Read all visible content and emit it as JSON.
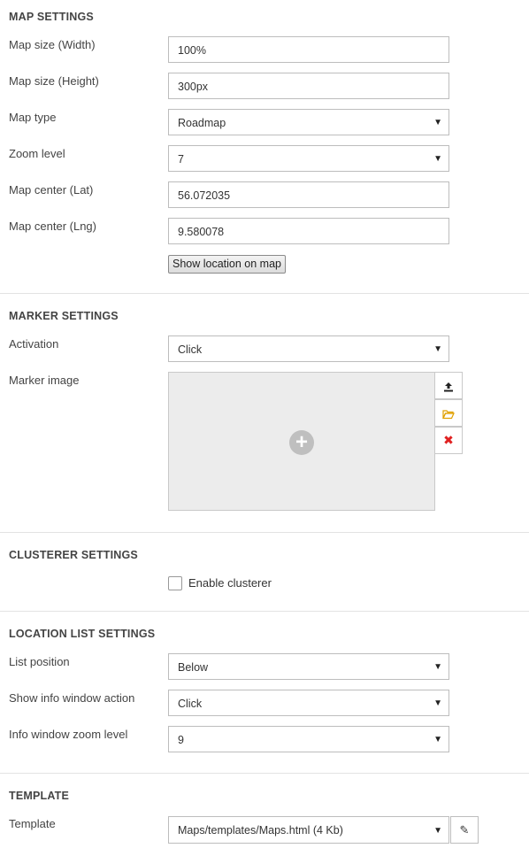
{
  "map_settings": {
    "title": "MAP SETTINGS",
    "width_label": "Map size (Width)",
    "width_value": "100%",
    "height_label": "Map size (Height)",
    "height_value": "300px",
    "type_label": "Map type",
    "type_value": "Roadmap",
    "zoom_label": "Zoom level",
    "zoom_value": "7",
    "lat_label": "Map center (Lat)",
    "lat_value": "56.072035",
    "lng_label": "Map center (Lng)",
    "lng_value": "9.580078",
    "show_button": "Show location on map"
  },
  "marker_settings": {
    "title": "MARKER SETTINGS",
    "activation_label": "Activation",
    "activation_value": "Click",
    "image_label": "Marker image",
    "icons": [
      "upload-icon",
      "folder-icon",
      "remove-icon"
    ]
  },
  "clusterer_settings": {
    "title": "CLUSTERER SETTINGS",
    "enable_label": "Enable clusterer",
    "enabled": false
  },
  "location_list_settings": {
    "title": "LOCATION LIST SETTINGS",
    "position_label": "List position",
    "position_value": "Below",
    "info_action_label": "Show info window action",
    "info_action_value": "Click",
    "info_zoom_label": "Info window zoom level",
    "info_zoom_value": "9"
  },
  "template": {
    "title": "TEMPLATE",
    "template_label": "Template",
    "template_value": "Maps/templates/Maps.html (4 Kb)"
  },
  "colors": {
    "remove_icon": "#e02020",
    "folder_icon": "#e0a000",
    "divider": "#e3e3e3"
  }
}
